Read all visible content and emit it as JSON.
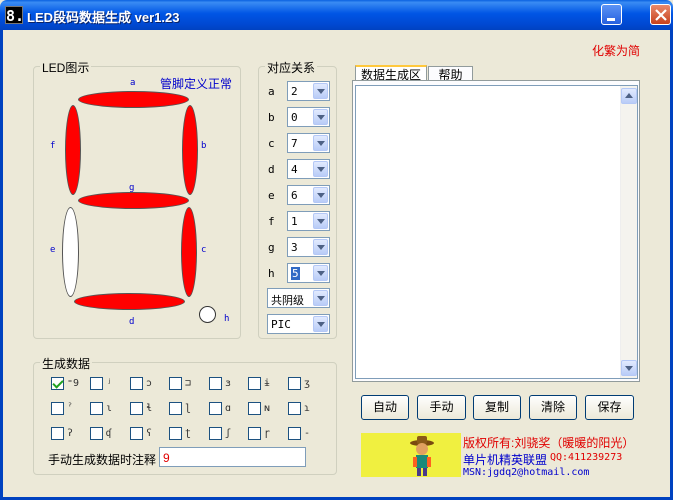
{
  "window": {
    "app_icon_glyph": "8.",
    "title": "LED段码数据生成 ver1.23",
    "trad_simp_toggle": "化繁为简"
  },
  "led_group": {
    "title": "LED图示",
    "pin_status": "管脚定义正常",
    "segments": {
      "a": {
        "label": "a",
        "state": "on"
      },
      "b": {
        "label": "b",
        "state": "on"
      },
      "c": {
        "label": "c",
        "state": "on"
      },
      "d": {
        "label": "d",
        "state": "on"
      },
      "e": {
        "label": "e",
        "state": "off"
      },
      "f": {
        "label": "f",
        "state": "on"
      },
      "g": {
        "label": "g",
        "state": "on"
      },
      "h": {
        "label": "h",
        "state": "off"
      }
    }
  },
  "mapping_group": {
    "title": "对应关系",
    "rows": [
      {
        "label": "a",
        "value": "2"
      },
      {
        "label": "b",
        "value": "0"
      },
      {
        "label": "c",
        "value": "7"
      },
      {
        "label": "d",
        "value": "4"
      },
      {
        "label": "e",
        "value": "6"
      },
      {
        "label": "f",
        "value": "1"
      },
      {
        "label": "g",
        "value": "3"
      },
      {
        "label": "h",
        "value": "5"
      }
    ],
    "common_type": "共阴级",
    "target": "PIC"
  },
  "tabs": [
    {
      "label": "数据生成区",
      "active": true
    },
    {
      "label": "帮助",
      "active": false
    }
  ],
  "buttons": {
    "auto": "自动",
    "manual": "手动",
    "copy": "复制",
    "clear": "清除",
    "save": "保存"
  },
  "generate_group": {
    "title": "生成数据",
    "checkboxes": [
      {
        "label": "⁼9",
        "checked": true
      },
      {
        "label": "ʲ",
        "checked": false
      },
      {
        "label": "ɔ",
        "checked": false
      },
      {
        "label": "⊐",
        "checked": false
      },
      {
        "label": "ɜ",
        "checked": false
      },
      {
        "label": "ɨ",
        "checked": false
      },
      {
        "label": "ʒ",
        "checked": false
      },
      {
        "label": "ˀ",
        "checked": false
      },
      {
        "label": "ɩ",
        "checked": false
      },
      {
        "label": "ɬ",
        "checked": false
      },
      {
        "label": "ɭ",
        "checked": false
      },
      {
        "label": "ɑ",
        "checked": false
      },
      {
        "label": "ɴ",
        "checked": false
      },
      {
        "label": "ɿ",
        "checked": false
      },
      {
        "label": "ʔ",
        "checked": false
      },
      {
        "label": "ʠ",
        "checked": false
      },
      {
        "label": "ʕ",
        "checked": false
      },
      {
        "label": "ʈ",
        "checked": false
      },
      {
        "label": "ʃ",
        "checked": false
      },
      {
        "label": "ɼ",
        "checked": false
      },
      {
        "label": "-",
        "checked": false
      }
    ],
    "comment_label": "手动生成数据时注释",
    "comment_value": "9"
  },
  "footer": {
    "copyright": "版权所有:刘骁奖（暖暖的阳光）",
    "org": "单片机精英联盟",
    "qq": "QQ:411239273",
    "msn": "MSN:jgdq2@hotmail.com"
  },
  "colors": {
    "segment_on": "#ff0000",
    "segment_off": "#ffffff",
    "accent_blue": "#0000cc",
    "accent_red": "#e00000"
  }
}
